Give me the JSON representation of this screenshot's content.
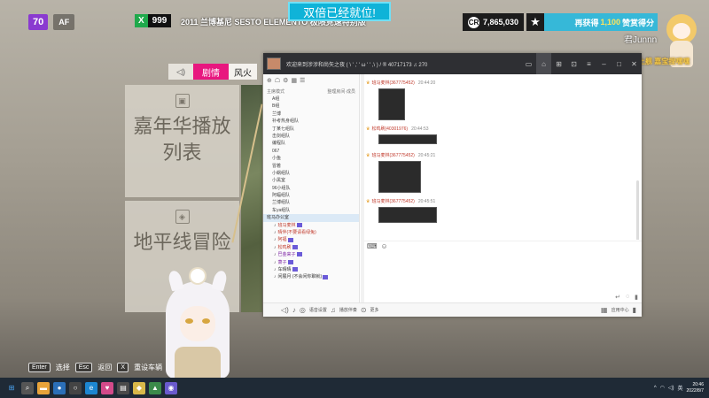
{
  "hud": {
    "level": "70",
    "player": "AF",
    "x_label": "X",
    "x_value": "999",
    "car_name": "2011 兰博基尼 SESTO ELEMENTO 极限竞速特别版",
    "banner": "双倍已经就位!",
    "credits": "7,865,030",
    "reward_prefix": "再获得",
    "reward_value": "1,100",
    "reward_suffix": "赞赏得分",
    "streamer_name": "君Junnn",
    "chibi_caption": "感谢上舰 嘉宝捏嘿嘿"
  },
  "menu": {
    "tab_active": "剧情",
    "tab_other": "风火",
    "cards": [
      {
        "icon": "film-icon",
        "title": "嘉年华播放列表"
      },
      {
        "icon": "ticket-icon",
        "title": "地平线冒险"
      }
    ]
  },
  "chat_window": {
    "title": "欢迎来到涉涉和尚矢之夜 ( \\ '  ,' ' ω ' ' ,\\  ) / ® 40717173 ♫ 270",
    "sidebar_header_left": "主席模式",
    "sidebar_header_right": "整理房间·成员",
    "groups": [
      "A组",
      "B组",
      "兰博",
      "补考热身组队",
      "丁某七组队",
      "击剑组队",
      "编程队",
      "067",
      "小鱼",
      "冒着",
      "小蜗组队",
      "小黑室",
      "96小组队",
      "阿蝠组队",
      "兰博组队",
      "车ya组队"
    ],
    "active_room": "班马办公室",
    "members": [
      {
        "name": "班马麦林",
        "cls": "r"
      },
      {
        "name": "晴伴(不要请看绿兔)",
        "cls": "r"
      },
      {
        "name": "阿福",
        "cls": "r"
      },
      {
        "name": "松鸣刷",
        "cls": "r"
      },
      {
        "name": "巴金来子",
        "cls": "p"
      },
      {
        "name": "萧子",
        "cls": "p"
      },
      {
        "name": "车晴晴",
        "cls": "k"
      },
      {
        "name": "闲展月 (不会闲你聊就)",
        "cls": "k"
      }
    ],
    "messages": [
      {
        "sender": "班马麦林(367775452)",
        "time": "20:44:20"
      },
      {
        "sender": "松鸣刷(40301976)",
        "time": "20:44:53"
      },
      {
        "sender": "班马麦林(367775452)",
        "time": "20:45:21"
      },
      {
        "sender": "班马麦林(367775452)",
        "time": "20:45:51"
      }
    ],
    "bottom_items": [
      "语音设置",
      "播放伴奏",
      "更多"
    ],
    "bottom_right": "应用中心"
  },
  "hints": [
    {
      "key": "Enter",
      "label": "选择"
    },
    {
      "key": "Esc",
      "label": "返回"
    },
    {
      "key": "X",
      "label": "重设车辆"
    }
  ],
  "taskbar": {
    "time": "20:46",
    "date": "2022/8/7",
    "lang": "英"
  }
}
